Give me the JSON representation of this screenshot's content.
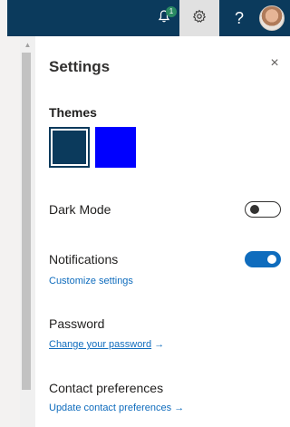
{
  "header": {
    "notification_count": "1",
    "help_glyph": "?",
    "icons": [
      "bell-icon",
      "gear-icon",
      "help-icon",
      "avatar"
    ]
  },
  "settings": {
    "title": "Settings",
    "close_glyph": "×",
    "themes_label": "Themes",
    "theme_swatches": [
      {
        "color": "#0b3a5c",
        "selected": true
      },
      {
        "color": "#0000ff",
        "selected": false
      }
    ],
    "dark_mode_label": "Dark Mode",
    "dark_mode_on": false,
    "notifications_label": "Notifications",
    "notifications_on": true,
    "customize_link": "Customize settings",
    "password_label": "Password",
    "change_password_link": "Change your password",
    "contact_label": "Contact preferences",
    "update_contact_link": "Update contact preferences",
    "arrow_glyph": "→"
  },
  "colors": {
    "topbar": "#0b3a5c",
    "accent": "#0f6cbd"
  }
}
